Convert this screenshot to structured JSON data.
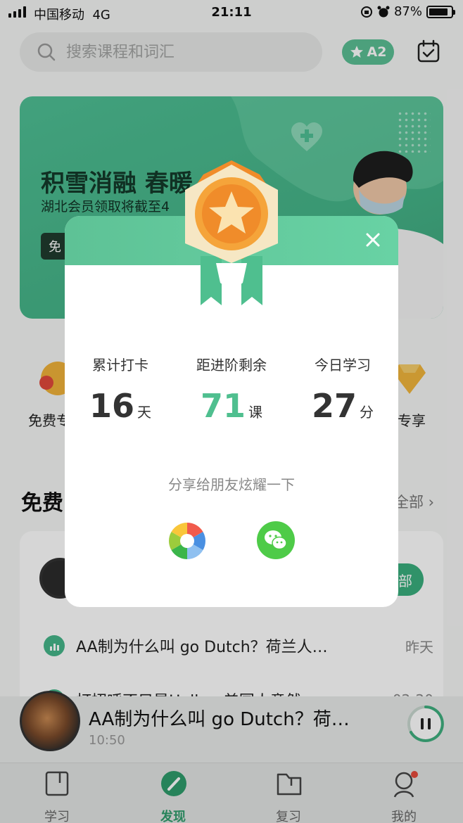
{
  "status_bar": {
    "carrier": "中国移动",
    "network": "4G",
    "time": "21:11",
    "battery": "87%",
    "battery_level": 0.87
  },
  "header": {
    "search_placeholder": "搜索课程和词汇",
    "level_badge": "A2"
  },
  "banner": {
    "title": "积雪消融 春暖",
    "subtitle": "湖北会员领取将截至4",
    "button": "免"
  },
  "categories": [
    {
      "label": "免费专"
    },
    {
      "label": "员专享"
    }
  ],
  "free_section": {
    "title": "免费",
    "see_all": "全部",
    "pill": "部",
    "items": [
      {
        "title": "AA制为什么叫 go Dutch？荷兰人…",
        "date": "昨天"
      },
      {
        "title": "打招呼不只是Hello，美国人意然…",
        "date": "02-20"
      }
    ]
  },
  "player": {
    "title": "AA制为什么叫 go Dutch？荷…",
    "time": "10:50"
  },
  "tabs": [
    {
      "label": "学习",
      "active": false
    },
    {
      "label": "发现",
      "active": true
    },
    {
      "label": "复习",
      "active": false
    },
    {
      "label": "我的",
      "active": false
    }
  ],
  "modal": {
    "stats": [
      {
        "label": "累计打卡",
        "value": "16",
        "unit": "天"
      },
      {
        "label": "距进阶剩余",
        "value": "71",
        "unit": "课"
      },
      {
        "label": "今日学习",
        "value": "27",
        "unit": "分"
      }
    ],
    "share_label": "分享给朋友炫耀一下"
  },
  "colors": {
    "accent": "#4fbf8f",
    "banner": "#46b589",
    "medal": "#f5a43a",
    "wechat": "#4ecb48"
  }
}
